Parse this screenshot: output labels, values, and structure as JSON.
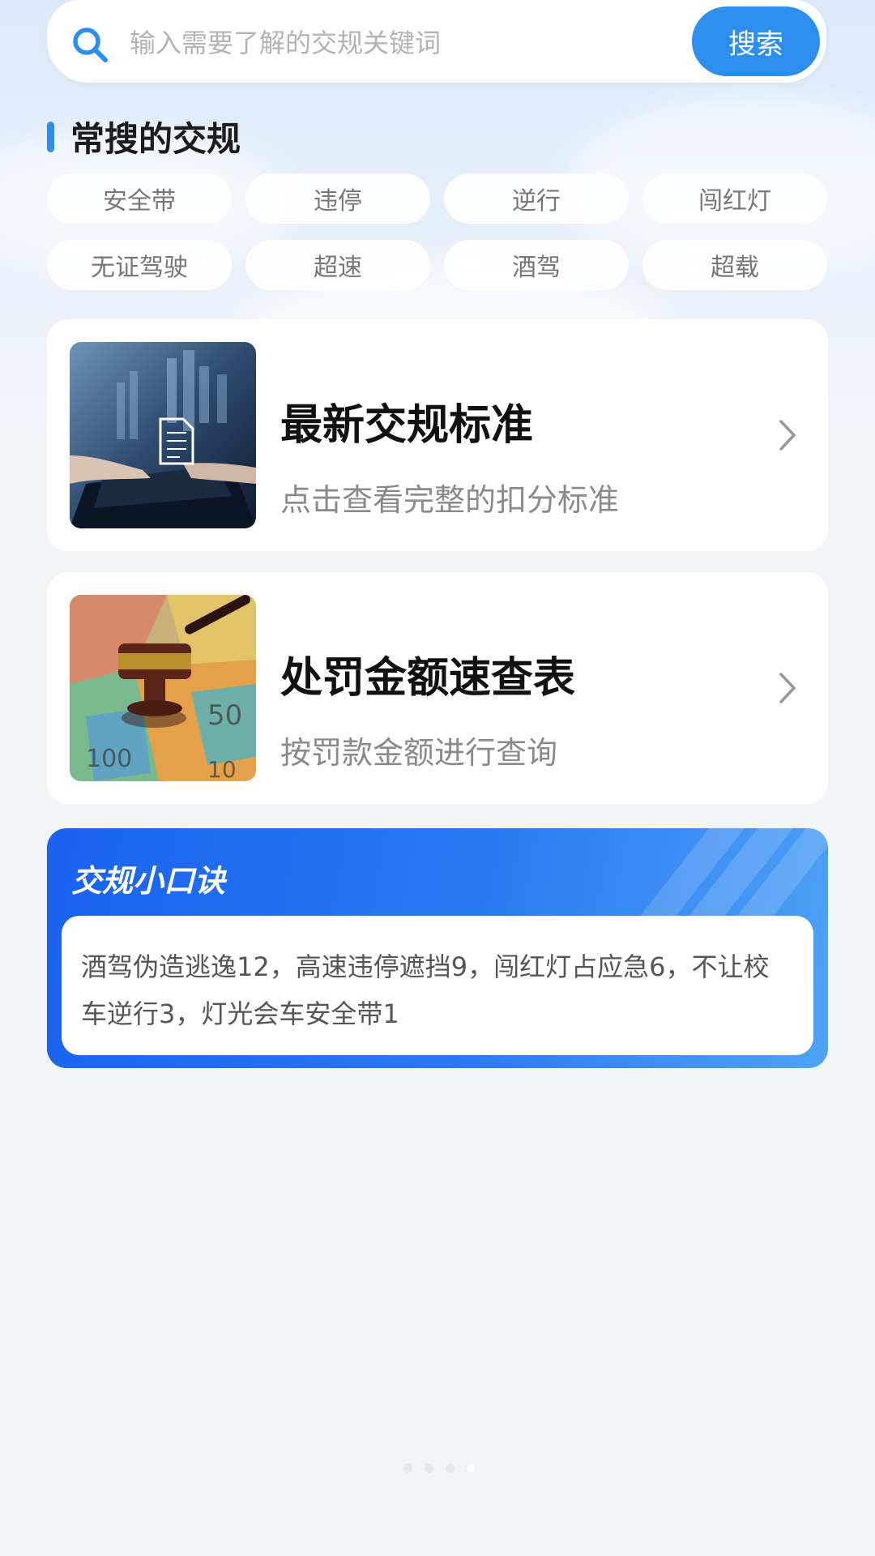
{
  "search": {
    "placeholder": "输入需要了解的交规关键词",
    "button_label": "搜索",
    "icon": "search-icon"
  },
  "popular": {
    "title": "常搜的交规",
    "tags": [
      "安全带",
      "违停",
      "逆行",
      "闯红灯",
      "无证驾驶",
      "超速",
      "酒驾",
      "超载"
    ]
  },
  "cards": [
    {
      "title": "最新交规标准",
      "subtitle": "点击查看完整的扣分标准",
      "image": "document-on-laptop-image",
      "icon": "chevron-right-icon"
    },
    {
      "title": "处罚金额速查表",
      "subtitle": "按罚款金额进行查询",
      "image": "gavel-on-banknotes-image",
      "icon": "chevron-right-icon"
    }
  ],
  "tips": {
    "title": "交规小口诀",
    "text": "酒驾伪造逃逸12，高速违停遮挡9，闯红灯占应急6，不让校车逆行3，灯光会车安全带1"
  },
  "pager": {
    "count": 4,
    "active_index": 3
  },
  "colors": {
    "accent": "#2c8fee",
    "banner_start": "#1a62ef",
    "banner_end": "#4ea3f6",
    "background": "#f2f4f8"
  }
}
